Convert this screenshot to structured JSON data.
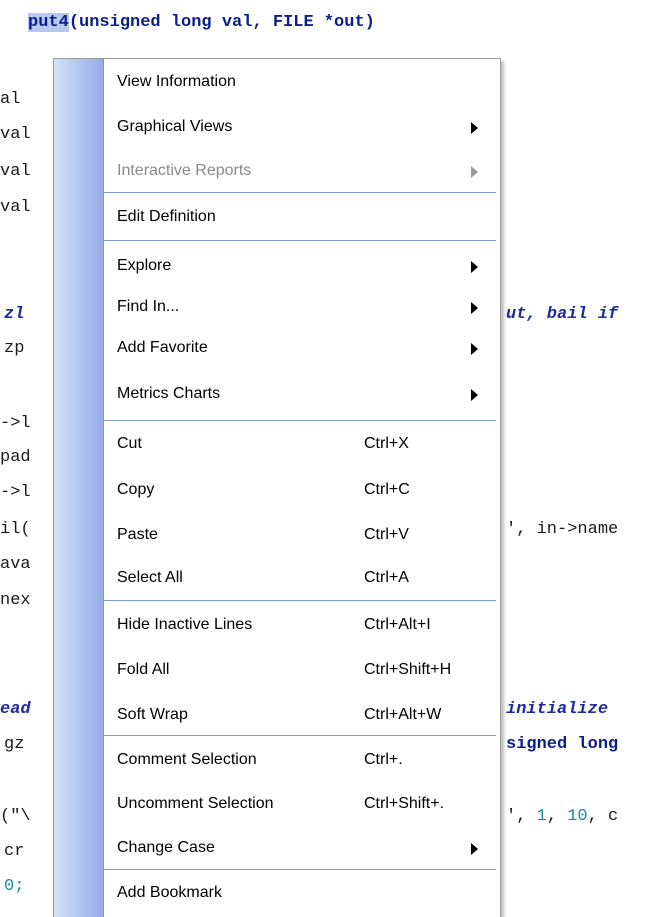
{
  "code": {
    "signature": {
      "fn": "put4",
      "params": "(unsigned long val, FILE *out)"
    },
    "left_fragments": [
      "al",
      "val",
      "val",
      "val",
      "zl",
      "zp",
      "->l",
      "pad",
      "->l",
      "il(",
      "ava",
      "nex",
      "ead",
      "gz",
      "(\"\\",
      "cr",
      "0;"
    ],
    "right_fragments": {
      "comment1": "ut, bail if",
      "name_call": "', in->name",
      "comment2": "initialize",
      "signed": "signed long",
      "args_prefix": "', ",
      "args_num1": "1",
      "args_sep": ", ",
      "args_num2": "10",
      "args_suffix": ", c"
    }
  },
  "menu": {
    "items": [
      {
        "label": "View Information",
        "shortcut": "",
        "submenu": false,
        "disabled": false
      },
      {
        "label": "Graphical Views",
        "shortcut": "",
        "submenu": true,
        "disabled": false
      },
      {
        "label": "Interactive Reports",
        "shortcut": "",
        "submenu": true,
        "disabled": true
      },
      {
        "label": "Edit Definition",
        "shortcut": "",
        "submenu": false,
        "disabled": false
      },
      {
        "label": "Explore",
        "shortcut": "",
        "submenu": true,
        "disabled": false
      },
      {
        "label": "Find In...",
        "shortcut": "",
        "submenu": true,
        "disabled": false
      },
      {
        "label": "Add Favorite",
        "shortcut": "",
        "submenu": true,
        "disabled": false
      },
      {
        "label": "Metrics Charts",
        "shortcut": "",
        "submenu": true,
        "disabled": false
      },
      {
        "label": "Cut",
        "shortcut": "Ctrl+X",
        "submenu": false,
        "disabled": false
      },
      {
        "label": "Copy",
        "shortcut": "Ctrl+C",
        "submenu": false,
        "disabled": false
      },
      {
        "label": "Paste",
        "shortcut": "Ctrl+V",
        "submenu": false,
        "disabled": false
      },
      {
        "label": "Select All",
        "shortcut": "Ctrl+A",
        "submenu": false,
        "disabled": false
      },
      {
        "label": "Hide Inactive Lines",
        "shortcut": "Ctrl+Alt+I",
        "submenu": false,
        "disabled": false
      },
      {
        "label": "Fold All",
        "shortcut": "Ctrl+Shift+H",
        "submenu": false,
        "disabled": false
      },
      {
        "label": "Soft Wrap",
        "shortcut": "Ctrl+Alt+W",
        "submenu": false,
        "disabled": false
      },
      {
        "label": "Comment Selection",
        "shortcut": "Ctrl+.",
        "submenu": false,
        "disabled": false
      },
      {
        "label": "Uncomment Selection",
        "shortcut": "Ctrl+Shift+.",
        "submenu": false,
        "disabled": false
      },
      {
        "label": "Change Case",
        "shortcut": "",
        "submenu": true,
        "disabled": false
      },
      {
        "label": "Add Bookmark",
        "shortcut": "",
        "submenu": false,
        "disabled": false
      }
    ]
  },
  "colors": {
    "keyword": "#0b1f8a",
    "selection": "#b7c9f0",
    "number": "#1d8f8f",
    "menu_gutter": "#b7c9f0",
    "separator": "#7f9bd6"
  }
}
